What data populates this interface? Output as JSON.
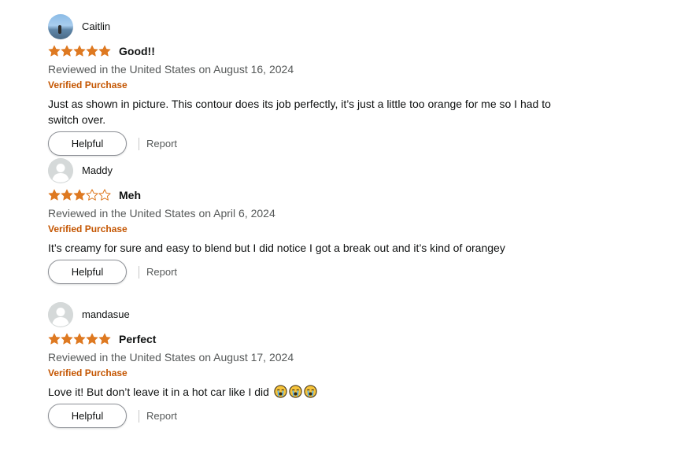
{
  "colors": {
    "star_filled": "#de7921",
    "verified": "#c45500",
    "meta_text": "#565959",
    "body_text": "#0f1111"
  },
  "reviews": [
    {
      "profile_name": "Caitlin",
      "avatar": "photo-avatar",
      "rating": 5,
      "title": "Good!!",
      "date": "Reviewed in the United States on August 16, 2024",
      "verified": "Verified Purchase",
      "body": "Just as shown in picture. This contour does its job perfectly, it’s just a little too orange for me so I had to switch over.",
      "helpful_label": "Helpful",
      "report_label": "Report"
    },
    {
      "profile_name": "Maddy",
      "avatar": "default-user-icon",
      "rating": 3,
      "title": "Meh",
      "date": "Reviewed in the United States on April 6, 2024",
      "verified": "Verified Purchase",
      "body": "It’s creamy for sure and easy to blend but I did notice I got a break out and it’s kind of orangey",
      "helpful_label": "Helpful",
      "report_label": "Report"
    },
    {
      "profile_name": "mandasue",
      "avatar": "default-user-icon",
      "rating": 5,
      "title": "Perfect",
      "date": "Reviewed in the United States on August 17, 2024",
      "verified": "Verified Purchase",
      "body": "Love it! But don’t leave it in a hot car like I did",
      "body_emoji": [
        "loudly-crying-face-icon",
        "loudly-crying-face-icon",
        "loudly-crying-face-icon"
      ],
      "helpful_label": "Helpful",
      "report_label": "Report"
    }
  ]
}
